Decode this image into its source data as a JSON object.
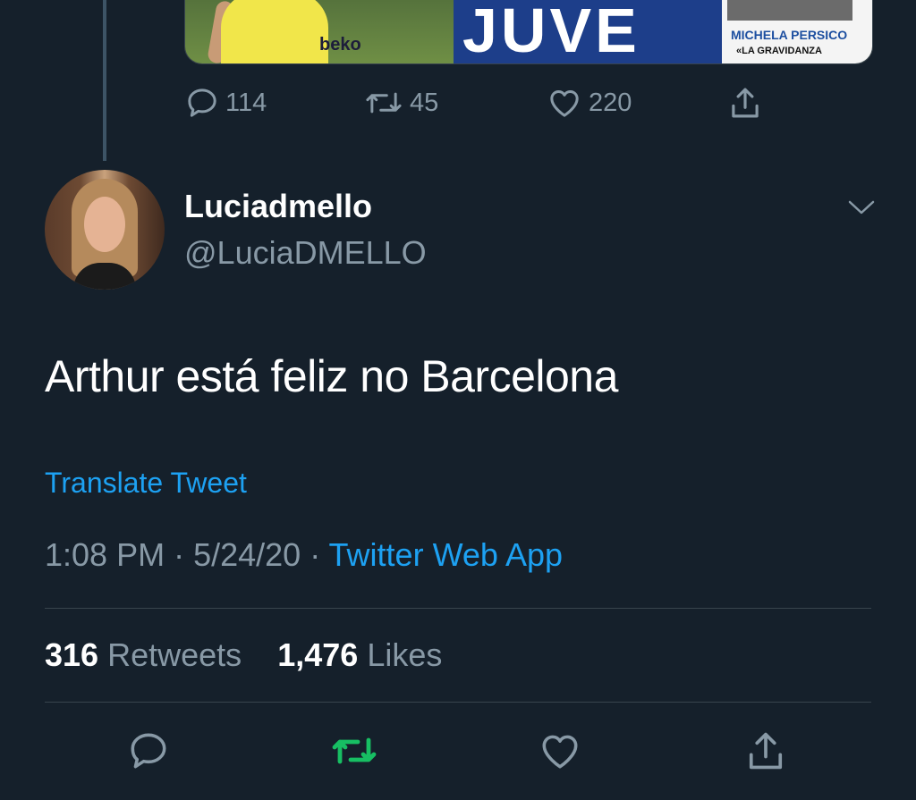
{
  "quoted_media": {
    "sponsor_text": "beko",
    "headline_text": "JUVE",
    "sidebar_name": "MICHELA PERSICO",
    "sidebar_sub": "«LA GRAVIDANZA"
  },
  "previous_tweet_actions": {
    "reply_count": "114",
    "retweet_count": "45",
    "like_count": "220"
  },
  "tweet": {
    "display_name": "Luciadmello",
    "handle": "@LuciaDMELLO",
    "text": "Arthur está feliz no Barcelona",
    "translate_label": "Translate Tweet",
    "time": "1:08 PM",
    "separator": " · ",
    "date": "5/24/20",
    "source": "Twitter Web App",
    "retweets_count": "316",
    "retweets_label": "Retweets",
    "likes_count": "1,476",
    "likes_label": "Likes"
  },
  "icons": {
    "reply": "speech-bubble-icon",
    "retweet": "retweet-arrows-icon",
    "like": "heart-icon",
    "share": "share-upload-icon",
    "more": "chevron-down-icon"
  },
  "colors": {
    "background": "#15202b",
    "accent": "#1da1f2",
    "secondary_text": "#8899a6",
    "retweet_active": "#17bf63"
  }
}
